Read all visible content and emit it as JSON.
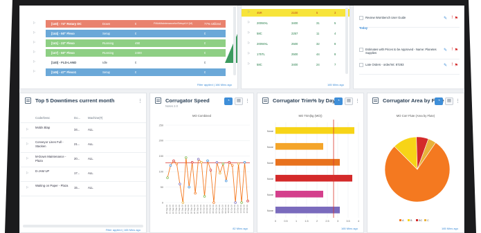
{
  "colors": {
    "red_row": "#e9826e",
    "blue_row": "#6ba8d8",
    "green_row": "#8ecf84",
    "yellow": "#f7e43a",
    "orange": "#f47920",
    "accent": "#3e8ed8"
  },
  "orders_table": {
    "rows": [
      {
        "name": "[140] - 74\" Rotary DC",
        "status": "Down",
        "value": "0",
        "reason": "FillUdMaintenancefor/Setup/LH (M)",
        "pct": "77% Utilized",
        "color": "red"
      },
      {
        "name": "[144] - 50\" Flexo",
        "status": "Setup",
        "value": "0",
        "reason": "",
        "pct": "0",
        "color": "blue"
      },
      {
        "name": "[141] - 23\" Flexo",
        "status": "Running",
        "value": "490",
        "reason": "",
        "pct": "0",
        "color": "green"
      },
      {
        "name": "[147] - 50\" Flexo",
        "status": "Running",
        "value": "2400",
        "reason": "",
        "pct": "0",
        "color": "green"
      },
      {
        "name": "[140] - FLD-LAND",
        "status": "Idle",
        "value": "0",
        "reason": "",
        "pct": "0",
        "color": "white"
      },
      {
        "name": "[149] - 47\" Flexo1",
        "status": "Setup",
        "value": "0",
        "reason": "",
        "pct": "0",
        "color": "blue"
      }
    ],
    "filter_text": "Filter applied",
    "updated": "166 Mins ago"
  },
  "flute_table": {
    "rows": [
      {
        "flute": "45R",
        "a": "2100",
        "b": "5",
        "c": "3",
        "highlight": true
      },
      {
        "flute": "200WXL",
        "a": "3400",
        "b": "31",
        "c": "5",
        "highlight": false
      },
      {
        "flute": "58C",
        "a": "2257",
        "b": "11",
        "c": "4",
        "highlight": false
      },
      {
        "flute": "200WXL",
        "a": "2500",
        "b": "32",
        "c": "8",
        "highlight": false
      },
      {
        "flute": "175TL",
        "a": "2500",
        "b": "44",
        "c": "8",
        "highlight": false
      },
      {
        "flute": "58C",
        "a": "3400",
        "b": "24",
        "c": "7",
        "highlight": false
      }
    ],
    "updated": "165 Mins ago"
  },
  "tasks": {
    "items": [
      {
        "text": "Review Wombench User Guide"
      },
      {
        "text": "Estimates with Prices to be Approved - Name: Planetes Supplies"
      },
      {
        "text": "Late Orders - order/mt: 87283"
      }
    ],
    "section": "Today"
  },
  "downtimes": {
    "title": "Top 5 Downtimes current month",
    "headers": [
      "Code/Desc",
      "Do...",
      "Machine(#)"
    ],
    "rows": [
      {
        "desc": "Molds Blap",
        "dur": "34...",
        "machine": "ALL"
      },
      {
        "desc": "Conveyor Lines Full - Stacken",
        "dur": "21...",
        "machine": "ALL"
      },
      {
        "desc": "M-Down Maintenance - Plaza",
        "dur": "20...",
        "machine": "ALL"
      },
      {
        "desc": "D-JAM UP",
        "dur": "17...",
        "machine": "ALL"
      },
      {
        "desc": "Waiting on Paper - Plaza",
        "dur": "15...",
        "machine": "ALL"
      }
    ],
    "filter_text": "Filter applied",
    "updated": "165 Mins ago"
  },
  "speed_panel": {
    "title": "Corrugator Speed",
    "subtitle": "Notes 2.0",
    "updated": "82 Mins ago"
  },
  "trim_panel": {
    "title": "Corrugator Trim% by Day",
    "updated": "165 Mins ago"
  },
  "area_panel": {
    "title": "Corrugator Area by Flute",
    "updated": "165 Mins ago"
  },
  "chart_data": [
    {
      "type": "line",
      "title": "MO Combined",
      "ylim": [
        0,
        250
      ],
      "yticks": [
        "250",
        "200",
        "150",
        "100",
        "50",
        "0"
      ],
      "x": [
        "20 Sep 19",
        "21 Sep 19",
        "22 Sep 19",
        "23 Sep 19",
        "24 Sep 19",
        "25 Sep 19",
        "26 Sep 19",
        "27 Sep 19",
        "28 Sep 19",
        "29 Sep 19",
        "30 Sep 19",
        "01 Oct 19",
        "02 Oct 19",
        "03 Oct 19",
        "04 Oct 19",
        "05 Oct 19",
        "06 Oct 19",
        "07 Oct 19",
        "08 Oct 19",
        "09 Oct 19",
        "10 Oct 19",
        "11 Oct 19",
        "12 Oct 19",
        "13 Oct 19",
        "14 Oct 19",
        "15 Oct 19",
        "16 Oct 19"
      ],
      "series": [
        {
          "values": [
            80,
            120,
            135,
            125,
            60,
            0,
            145,
            50,
            130,
            30,
            140,
            130,
            20,
            135,
            105,
            0,
            130,
            95,
            125,
            70,
            130,
            120,
            0,
            125,
            0,
            130,
            5
          ],
          "color": "#f47920"
        }
      ],
      "reference": {
        "value": 128,
        "color": "#d9342b"
      }
    },
    {
      "type": "bar",
      "title": "MO Trim(kg (MO))",
      "orientation": "horizontal",
      "categories": [
        "None",
        "None",
        "None",
        "None",
        "None",
        "None"
      ],
      "values": [
        3.8,
        2.3,
        3.1,
        3.7,
        2.3,
        3.1
      ],
      "colors": [
        "#f7d417",
        "#f4a52a",
        "#e8721e",
        "#d42a2a",
        "#d43f8c",
        "#7a6bbd"
      ],
      "xlim": [
        0,
        4
      ],
      "xticks": [
        "0",
        "0.5",
        "1",
        "1.5",
        "2",
        "2.5",
        "3",
        "3.5",
        "4"
      ],
      "reference": 2.8
    },
    {
      "type": "pie",
      "title": "MO Corr Flute (Area by Flute)",
      "slices": [
        {
          "value": 78,
          "color": "#f47920"
        },
        {
          "value": 12,
          "color": "#f7d417"
        },
        {
          "value": 6,
          "color": "#d42a2a"
        },
        {
          "value": 4,
          "color": "#e8b23a"
        }
      ],
      "legend": [
        "A",
        "B",
        "BC",
        "C"
      ]
    }
  ]
}
